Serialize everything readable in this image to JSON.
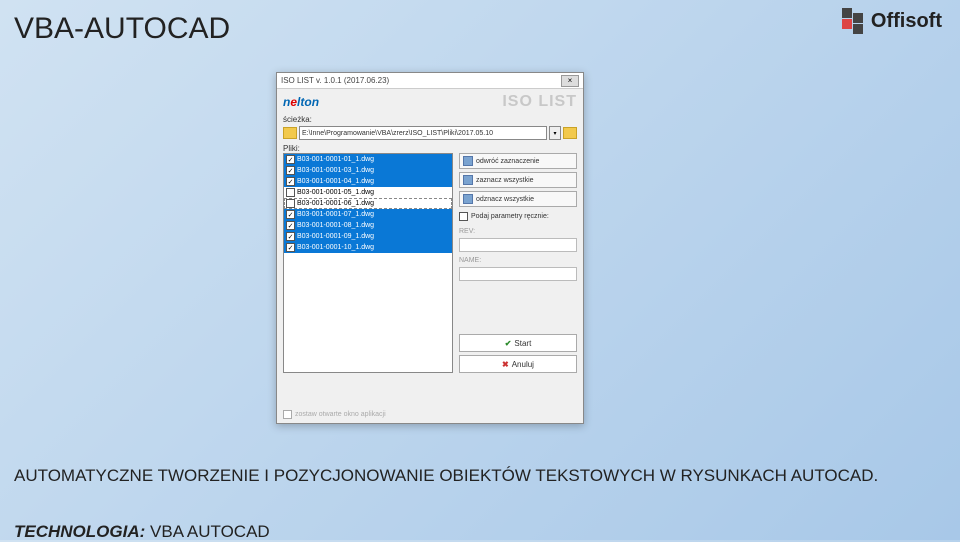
{
  "slide": {
    "title": "VBA-AUTOCAD",
    "brand": "Offisoft",
    "description": "AUTOMATYCZNE TWORZENIE I POZYCJONOWANIE OBIEKTÓW TEKSTOWYCH W RYSUNKACH AUTOCAD.",
    "tech_label": "TECHNOLOGIA:",
    "tech_value": "VBA AUTOCAD"
  },
  "dialog": {
    "title": "ISO LIST v. 1.0.1 (2017.06.23)",
    "close": "×",
    "logo_prefix": "n",
    "logo_mid": "e",
    "logo_suffix": "lton",
    "iso_list": "ISO LIST",
    "path_label": "ścieżka:",
    "path_value": "E:\\Inne\\Programowanie\\VBA\\zrerz\\ISO_LIST\\Pliki\\2017.05.10",
    "files_label": "Pliki:",
    "files": [
      {
        "checked": true,
        "selected": true,
        "name": "B03-001-0001-01_1.dwg"
      },
      {
        "checked": true,
        "selected": true,
        "name": "B03-001-0001-03_1.dwg"
      },
      {
        "checked": true,
        "selected": true,
        "name": "B03-001-0001-04_1.dwg"
      },
      {
        "checked": false,
        "selected": false,
        "name": "B03-001-0001-05_1.dwg"
      },
      {
        "checked": false,
        "selected": false,
        "dashed": true,
        "name": "B03-001-0001-06_1.dwg"
      },
      {
        "checked": true,
        "selected": true,
        "name": "B03-001-0001-07_1.dwg"
      },
      {
        "checked": true,
        "selected": true,
        "name": "B03-001-0001-08_1.dwg"
      },
      {
        "checked": true,
        "selected": true,
        "name": "B03-001-0001-09_1.dwg"
      },
      {
        "checked": true,
        "selected": true,
        "name": "B03-001-0001-10_1.dwg"
      }
    ],
    "side_buttons": {
      "b1": "odwróć zaznaczenie",
      "b2": "zaznacz wszystkie",
      "b3": "odznacz wszystkie"
    },
    "chk_param": "Podaj parametry ręcznie:",
    "fld1_label": "REV:",
    "fld2_label": "NAME:",
    "start": "Start",
    "cancel": "Anuluj",
    "footer_chk": "zostaw otwarte okno aplikacji"
  }
}
